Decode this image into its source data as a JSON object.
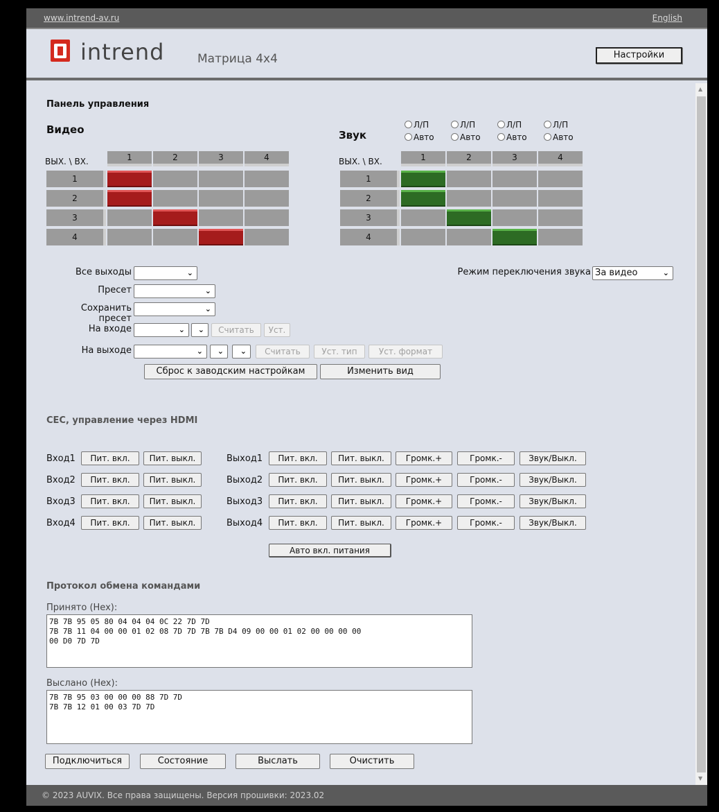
{
  "topbar": {
    "site_link": "www.intrend-av.ru",
    "lang_link": "English"
  },
  "header": {
    "logo_text": "intrend",
    "product": "Матрица 4x4",
    "settings_button": "Настройки"
  },
  "panel_title": "Панель управления",
  "video": {
    "title": "Видео",
    "corner": "ВЫХ. \\ ВХ.",
    "inputs": [
      "1",
      "2",
      "3",
      "4"
    ],
    "outputs": [
      "1",
      "2",
      "3",
      "4"
    ],
    "routing": [
      1,
      1,
      2,
      3
    ],
    "active_color": "#a51c1c"
  },
  "audio": {
    "title": "Звук",
    "corner": "ВЫХ. \\ ВХ.",
    "inputs": [
      "1",
      "2",
      "3",
      "4"
    ],
    "outputs": [
      "1",
      "2",
      "3",
      "4"
    ],
    "routing": [
      1,
      1,
      2,
      3
    ],
    "active_color": "#2d6b24",
    "radio_lr": "Л/П",
    "radio_auto": "Авто"
  },
  "controls": {
    "all_outputs_label": "Все выходы",
    "preset_label": "Пресет",
    "save_preset_label": "Сохранить пресет",
    "on_input_label": "На входе",
    "on_output_label": "На выходе",
    "read_button": "Считать",
    "set_button": "Уст.",
    "set_type_button": "Уст. тип",
    "set_format_button": "Уст. формат",
    "factory_reset_button": "Сброс к заводским настройкам",
    "change_view_button": "Изменить вид",
    "audio_mode_label": "Режим переключения звука",
    "audio_mode_value": "За видео"
  },
  "cec": {
    "title": "CEC, управление через HDMI",
    "inputs": [
      "Вход1",
      "Вход2",
      "Вход3",
      "Вход4"
    ],
    "outputs": [
      "Выход1",
      "Выход2",
      "Выход3",
      "Выход4"
    ],
    "power_on": "Пит. вкл.",
    "power_off": "Пит. выкл.",
    "vol_up": "Громк.+",
    "vol_down": "Громк.-",
    "mute": "Звук/Выкл.",
    "auto_power": "Авто вкл. питания"
  },
  "protocol": {
    "title": "Протокол обмена командами",
    "received_label": "Принято (Hex):",
    "received_text": "7B 7B 95 05 80 04 04 04 0C 22 7D 7D\n7B 7B 11 04 00 00 01 02 08 7D 7D 7B 7B D4 09 00 00 01 02 00 00 00 00\n00 D0 7D 7D",
    "sent_label": "Выслано (Hex):",
    "sent_text": "7B 7B 95 03 00 00 00 88 7D 7D\n7B 7B 12 01 00 03 7D 7D",
    "connect_button": "Подключиться",
    "state_button": "Состояние",
    "send_button": "Выслать",
    "clear_button": "Очистить"
  },
  "footer": {
    "text": "© 2023 AUVIX. Все права защищены. Версия прошивки:  2023.02"
  }
}
